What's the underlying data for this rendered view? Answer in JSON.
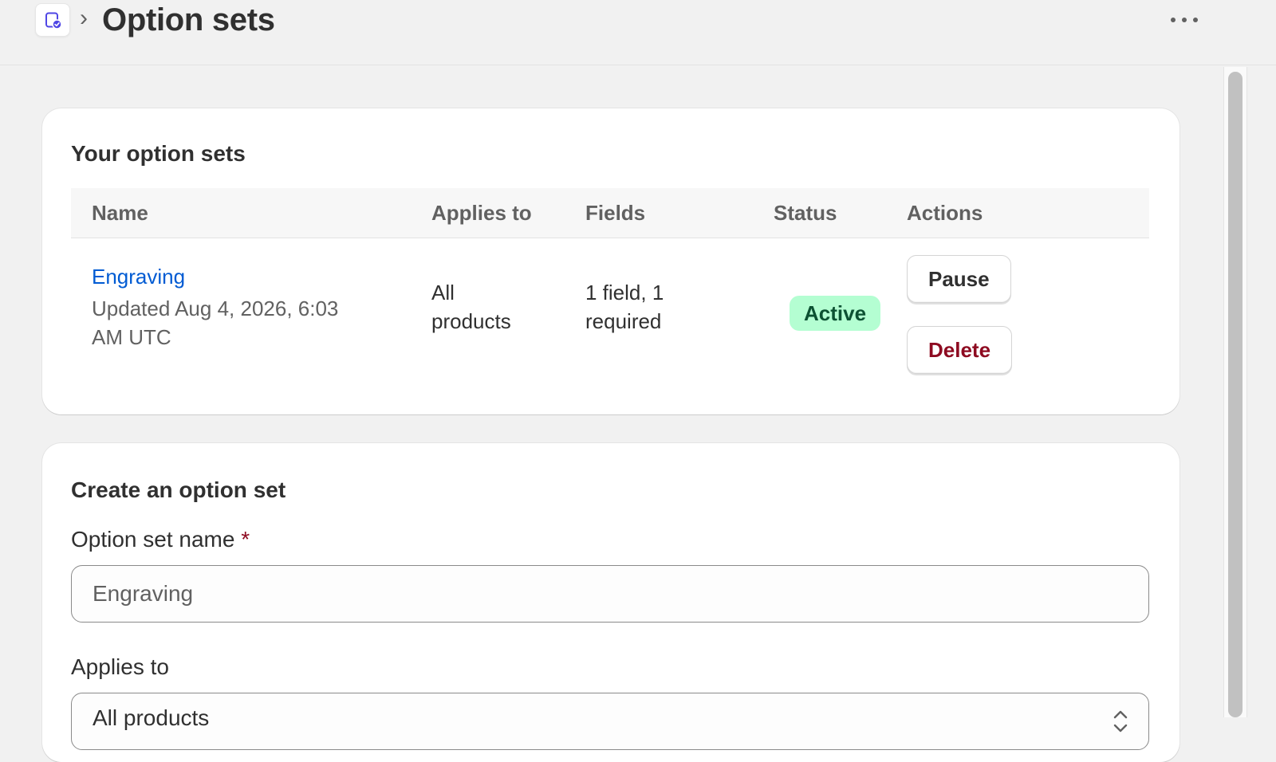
{
  "header": {
    "app_icon": "app-option-sets-icon",
    "separator_icon": "chevron-right-icon",
    "title": "Option sets",
    "more_icon": "more-horizontal-icon"
  },
  "option_sets_card": {
    "heading": "Your option sets",
    "columns": [
      "Name",
      "Applies to",
      "Fields",
      "Status",
      "Actions"
    ],
    "rows": [
      {
        "name": "Engraving",
        "updated_line1": "Updated Aug 4, 2026, 6:03",
        "updated_line2": "AM UTC",
        "applies_line1": "All",
        "applies_line2": "products",
        "fields_line1": "1 field, 1",
        "fields_line2": "required",
        "status": "Active",
        "actions": {
          "pause": "Pause",
          "delete": "Delete"
        }
      }
    ]
  },
  "create_card": {
    "heading": "Create an option set",
    "name_label": "Option set name",
    "required_marker": "*",
    "name_placeholder": "Engraving",
    "applies_label": "Applies to",
    "applies_value": "All products",
    "applies_icon": "chevron-up-down-icon"
  },
  "colors": {
    "link": "#005bd3",
    "badge_bg": "#b4fed2",
    "badge_text": "#0c5132",
    "danger": "#8e0b21",
    "accent_icon": "#4f46e5"
  }
}
